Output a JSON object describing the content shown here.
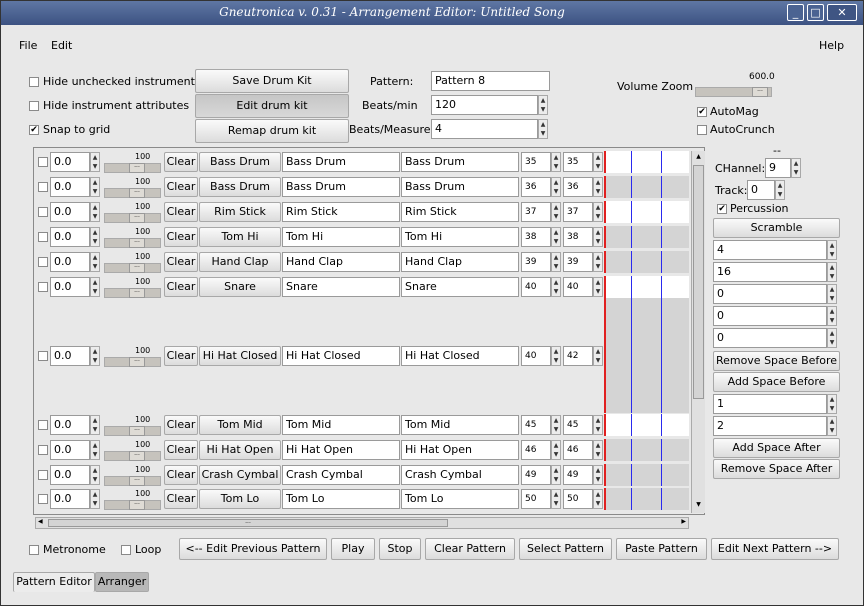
{
  "window": {
    "title": "Gneutronica v. 0.31 - Arrangement Editor: Untitled Song"
  },
  "menu": {
    "file": "File",
    "edit": "Edit",
    "help": "Help"
  },
  "options": {
    "hide_unchecked": "Hide unchecked instruments",
    "hide_attributes": "Hide instrument attributes",
    "snap_to_grid": "Snap to grid"
  },
  "kit_buttons": {
    "save": "Save Drum Kit",
    "edit": "Edit drum kit",
    "remap": "Remap drum kit"
  },
  "pattern": {
    "pattern_label": "Pattern:",
    "pattern_value": "Pattern 8",
    "bpm_label": "Beats/min",
    "bpm_value": "120",
    "bpmeasure_label": "Beats/Measure",
    "bpmeasure_value": "4"
  },
  "volume_zoom": {
    "label": "Volume Zoom",
    "value": "600.0",
    "automag": "AutoMag",
    "autocrunch": "AutoCrunch"
  },
  "instruments": [
    {
      "volume": "0.0",
      "level": "100",
      "clear": "Clear",
      "name": "Bass Drum",
      "name2": "Bass Drum",
      "name3": "Bass Drum",
      "note1": "35",
      "note2": "35"
    },
    {
      "volume": "0.0",
      "level": "100",
      "clear": "Clear",
      "name": "Bass Drum",
      "name2": "Bass Drum",
      "name3": "Bass Drum",
      "note1": "36",
      "note2": "36"
    },
    {
      "volume": "0.0",
      "level": "100",
      "clear": "Clear",
      "name": "Rim Stick",
      "name2": "Rim Stick",
      "name3": "Rim Stick",
      "note1": "37",
      "note2": "37"
    },
    {
      "volume": "0.0",
      "level": "100",
      "clear": "Clear",
      "name": "Tom Hi",
      "name2": "Tom Hi",
      "name3": "Tom Hi",
      "note1": "38",
      "note2": "38"
    },
    {
      "volume": "0.0",
      "level": "100",
      "clear": "Clear",
      "name": "Hand Clap",
      "name2": "Hand Clap",
      "name3": "Hand Clap",
      "note1": "39",
      "note2": "39"
    },
    {
      "volume": "0.0",
      "level": "100",
      "clear": "Clear",
      "name": "Snare",
      "name2": "Snare",
      "name3": "Snare",
      "note1": "40",
      "note2": "40"
    },
    {
      "volume": "0.0",
      "level": "100",
      "clear": "Clear",
      "name": "Hi Hat Closed",
      "name2": "Hi Hat Closed",
      "name3": "Hi Hat Closed",
      "note1": "40",
      "note2": "42"
    },
    {
      "volume": "0.0",
      "level": "100",
      "clear": "Clear",
      "name": "Tom Mid",
      "name2": "Tom Mid",
      "name3": "Tom Mid",
      "note1": "45",
      "note2": "45"
    },
    {
      "volume": "0.0",
      "level": "100",
      "clear": "Clear",
      "name": "Hi Hat Open",
      "name2": "Hi Hat Open",
      "name3": "Hi Hat Open",
      "note1": "46",
      "note2": "46"
    },
    {
      "volume": "0.0",
      "level": "100",
      "clear": "Clear",
      "name": "Crash Cymbal",
      "name2": "Crash Cymbal",
      "name3": "Crash Cymbal",
      "note1": "49",
      "note2": "49"
    },
    {
      "volume": "0.0",
      "level": "100",
      "clear": "Clear",
      "name": "Tom Lo",
      "name2": "Tom Lo",
      "name3": "Tom Lo",
      "note1": "50",
      "note2": "50"
    }
  ],
  "right_panel": {
    "dash": "--",
    "channel_label": "CHannel:",
    "channel_value": "9",
    "track_label": "Track:",
    "track_value": "0",
    "percussion": "Percussion",
    "scramble": "Scramble",
    "values_a": [
      "4",
      "16",
      "0",
      "0",
      "0"
    ],
    "remove_before": "Remove Space Before",
    "add_before": "Add Space Before",
    "values_b": [
      "1",
      "2"
    ],
    "add_after": "Add Space After",
    "remove_after": "Remove Space After"
  },
  "bottom": {
    "metronome": "Metronome",
    "loop": "Loop",
    "prev": "<-- Edit Previous Pattern",
    "play": "Play",
    "stop": "Stop",
    "clear_pattern": "Clear Pattern",
    "select_pattern": "Select Pattern",
    "paste_pattern": "Paste Pattern",
    "next": "Edit Next Pattern -->"
  },
  "tabs": {
    "pattern_editor": "Pattern Editor",
    "arranger": "Arranger"
  },
  "scroll": {
    "grip": "..."
  }
}
